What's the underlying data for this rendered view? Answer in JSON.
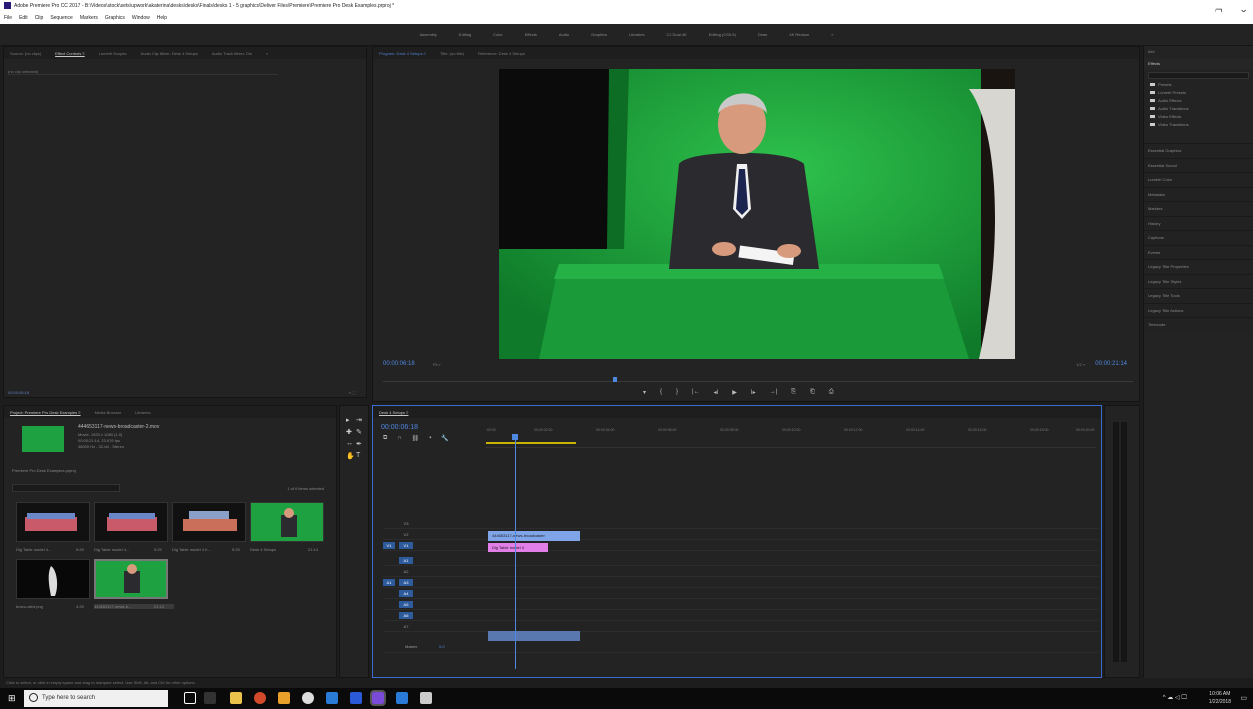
{
  "window": {
    "title": "Adobe Premiere Pro CC 2017 - B:\\Videos\\stock\\sets\\upwork\\akaterina\\desks\\desks\\Finals\\desks 1 - 5 graphics\\Deliver Files\\Premiere\\Premiere Pro Desk Examples.prproj *",
    "controls": [
      "–",
      "❐",
      "✕"
    ]
  },
  "menu": [
    "File",
    "Edit",
    "Clip",
    "Sequence",
    "Markers",
    "Graphics",
    "Window",
    "Help"
  ],
  "workspaces": [
    "Assembly",
    "Editing",
    "Color",
    "Effects",
    "Audio",
    "Graphics",
    "Libraries",
    "CJ Dual 4K",
    "Editing (CS5.5)",
    "Dean",
    "4K Reduce",
    "»"
  ],
  "effect_controls": {
    "tabs": [
      "Source: (no clips)",
      "Effect Controls ≡",
      "Lumetri Scopes",
      "Audio Clip Mixer: Desk 4 Setups",
      "Audio Track Mixer: Dis",
      "»"
    ],
    "active_tab": "Effect Controls ≡",
    "no_clip": "(no clip selected)",
    "timecode": "00:00:06:18",
    "footer_icons": "▿ ⬚"
  },
  "program_monitor": {
    "tabs": [
      "Program: Desk 4 Setups ≡",
      "Title: (no title)",
      "Reference: Desk 4 Setups"
    ],
    "timecode": "00:00:06:18",
    "fit": "Fit ▿",
    "quality": "1/2 ▿",
    "duration": "00:00:21:14",
    "transport": [
      "▾",
      "{",
      "}",
      "|←",
      "◂I",
      "▶",
      "I▸",
      "→|",
      "⎘",
      "⎗",
      "⎙"
    ]
  },
  "right_panels": {
    "info": "Info",
    "effects_header": "Effects",
    "effects_items": [
      "Presets",
      "Lumetri Presets",
      "Audio Effects",
      "Audio Transitions",
      "Video Effects",
      "Video Transitions"
    ],
    "sections": [
      "Essential Graphics",
      "Essential Sound",
      "Lumetri Color",
      "Metadata",
      "Markers",
      "History",
      "Captions",
      "Events",
      "Legacy Title Properties",
      "Legacy Title Styles",
      "Legacy Title Tools",
      "Legacy Title Actions",
      "Timecode"
    ]
  },
  "project": {
    "tabs": [
      "Project: Premiere Pro Desk Examples ≡",
      "Media Browser",
      "Libraries"
    ],
    "clip_title": "444653117-news-broadcaster-2.mov",
    "clip_meta": [
      "Movie, 1920 x 1080 (1.0)",
      "00:00:21:14, 23.976 fps",
      "48000 Hz - 32-bit - Stereo"
    ],
    "path": "Premiere Pro Desk Examples.prproj",
    "selected": "1 of 6 items selected",
    "items": [
      {
        "name": "Dig Table model 4...",
        "dur": "5:29"
      },
      {
        "name": "Dig Table model 4...",
        "dur": "5:29"
      },
      {
        "name": "Dig Table model 4 K...",
        "dur": "5:29"
      },
      {
        "name": "Desk 4 Setups",
        "dur": "21:14"
      },
      {
        "name": "bravo-alert.png",
        "dur": "4:29"
      },
      {
        "name": "444653117-news-b...",
        "dur": "21:14"
      }
    ]
  },
  "timeline": {
    "tab": "Desk 4 Setups ≡",
    "timecode": "00:00:06:18",
    "ruler": [
      ":00:00",
      "00:00:02:00",
      "00:00:04:00",
      "00:00:06:00",
      "00:00:08:00",
      "00:00:10:00",
      "00:00:12:00",
      "00:00:14:00",
      "00:00:16:00",
      "00:00:18:00",
      "00:00:20:00"
    ],
    "video_tracks": [
      "V3",
      "V2",
      "V1"
    ],
    "audio_tracks": [
      "A1",
      "A2",
      "A3",
      "A4",
      "A5",
      "A6",
      "A7"
    ],
    "master": "Master",
    "master_val": "0.0",
    "clip1": "444653117-news-broadcaster",
    "clip2": "Dig Table model 4"
  },
  "status": "Click to select, or click in empty space and drag to marquee select. Use Shift, Alt, and Ctrl for other options.",
  "taskbar": {
    "search_placeholder": "Type here to search",
    "time": "10:06 AM",
    "date": "1/22/2018"
  }
}
